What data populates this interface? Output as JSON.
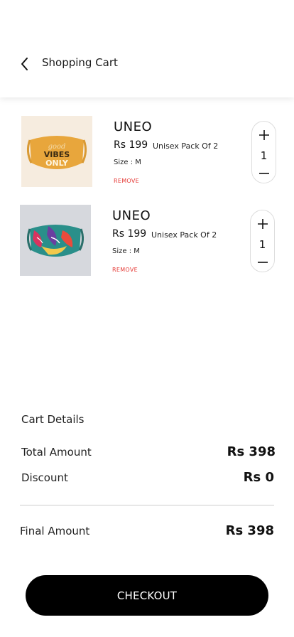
{
  "header": {
    "title": "Shopping Cart",
    "back_icon": "chevron-left-icon"
  },
  "items": [
    {
      "brand": "UNEO",
      "price": "Rs 199",
      "pack": "Unisex Pack Of 2",
      "size": "Size : M",
      "remove": "REMOVE",
      "quantity": "1",
      "image_text_top": "good",
      "image_text_mid": "VIBES",
      "image_text_bottom": "ONLY",
      "image_bg": "#f6ecdf",
      "mask_color": "#e8a63c"
    },
    {
      "brand": "UNEO",
      "price": "Rs 199",
      "pack": "Unisex Pack Of 2",
      "size": "Size : M",
      "remove": "REMOVE",
      "quantity": "1",
      "image_bg": "#d6d8dd"
    }
  ],
  "cart_details": {
    "title": "Cart Details",
    "total_label": "Total Amount",
    "total_value": "Rs 398",
    "discount_label": "Discount",
    "discount_value": "Rs 0",
    "final_label": "Final Amount",
    "final_value": "Rs 398"
  },
  "checkout_label": "CHECKOUT",
  "colors": {
    "accent": "#000000",
    "remove": "#e53935"
  }
}
